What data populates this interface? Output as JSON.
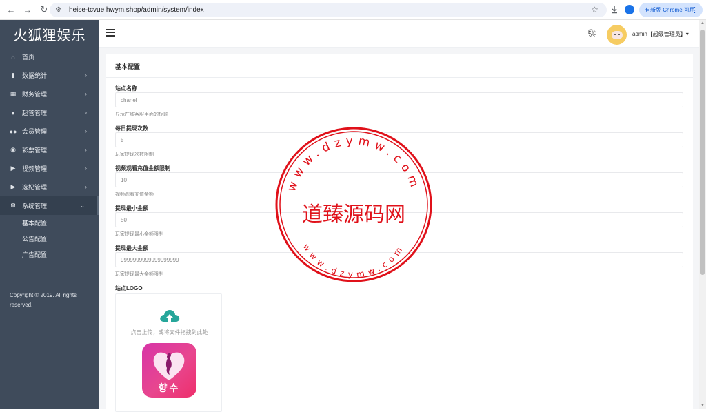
{
  "browser": {
    "url": "heise-tcvue.hwym.shop/admin/system/index",
    "update_label": "有新版 Chrome 可用"
  },
  "sidebar": {
    "brand": "火狐狸娱乐",
    "items": [
      {
        "label": "首页",
        "icon": "home-icon",
        "glyph": "⌂"
      },
      {
        "label": "数据统计",
        "icon": "bar-chart-icon",
        "glyph": "▮",
        "chevron": "›"
      },
      {
        "label": "财务管理",
        "icon": "bank-icon",
        "glyph": "▦",
        "chevron": "›"
      },
      {
        "label": "超管管理",
        "icon": "user-icon",
        "glyph": "●",
        "chevron": "›"
      },
      {
        "label": "会员管理",
        "icon": "users-icon",
        "glyph": "●●",
        "chevron": "›"
      },
      {
        "label": "彩票管理",
        "icon": "gamepad-icon",
        "glyph": "◉",
        "chevron": "›"
      },
      {
        "label": "视频管理",
        "icon": "video-icon",
        "glyph": "▶",
        "chevron": "›"
      },
      {
        "label": "选妃管理",
        "icon": "video-icon-2",
        "glyph": "▶",
        "chevron": "›"
      },
      {
        "label": "系统管理",
        "icon": "gear-icon",
        "glyph": "✻",
        "chevron": "⌄"
      }
    ],
    "submenu": [
      "基本配置",
      "公告配置",
      "广告配置"
    ],
    "copyright": "Copyright © 2019. All rights reserved."
  },
  "header": {
    "user": "admin【超级管理员】▾"
  },
  "card": {
    "title": "基本配置",
    "fields": [
      {
        "label": "站点名称",
        "value": "chanel",
        "help": "显示在线客服里面的标题"
      },
      {
        "label": "每日提现次数",
        "value": "5",
        "help": "玩家提现次数限制"
      },
      {
        "label": "视频观看充值金额限制",
        "value": "10",
        "help": "视频观看充值金额"
      },
      {
        "label": "提现最小金额",
        "value": "50",
        "help": "玩家提现最小金额限制"
      },
      {
        "label": "提现最大金额",
        "value": "9999999999999999999",
        "help": "玩家提现最大金额限制"
      }
    ],
    "logo_label": "站点LOGO",
    "upload_hint": "点击上传，或将文件拖拽到此处",
    "logo_text": "향수"
  },
  "watermark": {
    "top_text": "www.dzymw.com",
    "center_text": "道臻源码网",
    "bottom_text": "www.dzymw.com"
  },
  "colors": {
    "sidebar_bg": "#3f4b5b",
    "accent_teal": "#26a69a",
    "watermark_red": "#e0111a"
  }
}
